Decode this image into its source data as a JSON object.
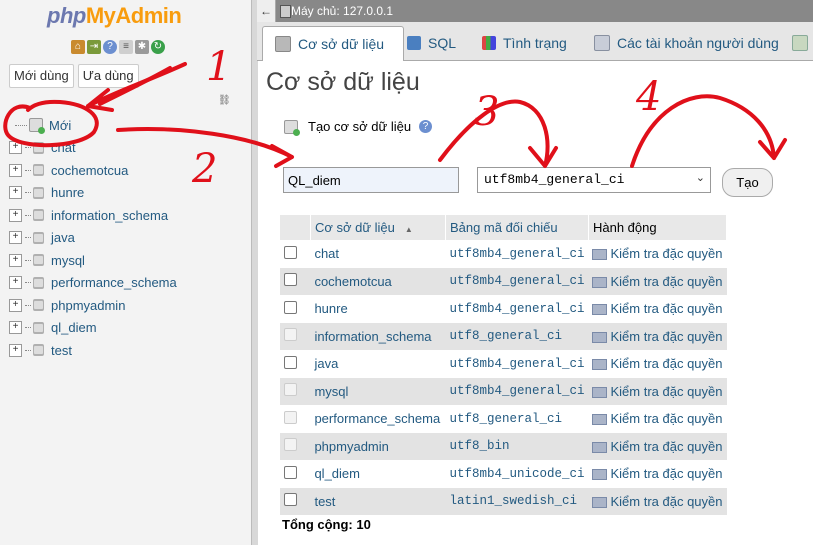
{
  "sidebar": {
    "logo": {
      "php": "php",
      "my": "My",
      "admin": "Admin"
    },
    "quick_icons": [
      "home-icon",
      "logout-icon",
      "help-icon",
      "docs-icon",
      "settings-icon",
      "reload-icon"
    ],
    "recent_tabs": [
      "Mới dùng",
      "Ưa dùng"
    ],
    "new_label": "Mới",
    "databases": [
      "chat",
      "cochemotcua",
      "hunre",
      "information_schema",
      "java",
      "mysql",
      "performance_schema",
      "phpmyadmin",
      "ql_diem",
      "test"
    ]
  },
  "server_bar": {
    "collapse": "←",
    "label": "Máy chủ: 127.0.0.1"
  },
  "tabs": [
    {
      "label": "Cơ sở dữ liệu",
      "icon": "database-icon"
    },
    {
      "label": "SQL",
      "icon": "sql-icon"
    },
    {
      "label": "Tình trạng",
      "icon": "status-icon"
    },
    {
      "label": "Các tài khoản người dùng",
      "icon": "users-icon"
    }
  ],
  "main": {
    "title": "Cơ sở dữ liệu",
    "create_label": "Tạo cơ sở dữ liệu",
    "db_name_value": "QL_diem",
    "collation_value": "utf8mb4_general_ci",
    "create_button": "Tạo",
    "total": "Tổng cộng: 10"
  },
  "table": {
    "headers": [
      "Cơ sở dữ liệu",
      "Bảng mã đối chiếu",
      "Hành động"
    ],
    "rows": [
      {
        "name": "chat",
        "collation": "utf8mb4_general_ci",
        "action": "Kiểm tra đặc quyền",
        "enabled": true
      },
      {
        "name": "cochemotcua",
        "collation": "utf8mb4_general_ci",
        "action": "Kiểm tra đặc quyền",
        "enabled": true
      },
      {
        "name": "hunre",
        "collation": "utf8mb4_general_ci",
        "action": "Kiểm tra đặc quyền",
        "enabled": true
      },
      {
        "name": "information_schema",
        "collation": "utf8_general_ci",
        "action": "Kiểm tra đặc quyền",
        "enabled": false
      },
      {
        "name": "java",
        "collation": "utf8mb4_general_ci",
        "action": "Kiểm tra đặc quyền",
        "enabled": true
      },
      {
        "name": "mysql",
        "collation": "utf8mb4_general_ci",
        "action": "Kiểm tra đặc quyền",
        "enabled": false
      },
      {
        "name": "performance_schema",
        "collation": "utf8_general_ci",
        "action": "Kiểm tra đặc quyền",
        "enabled": false
      },
      {
        "name": "phpmyadmin",
        "collation": "utf8_bin",
        "action": "Kiểm tra đặc quyền",
        "enabled": false
      },
      {
        "name": "ql_diem",
        "collation": "utf8mb4_unicode_ci",
        "action": "Kiểm tra đặc quyền",
        "enabled": true
      },
      {
        "name": "test",
        "collation": "latin1_swedish_ci",
        "action": "Kiểm tra đặc quyền",
        "enabled": true
      }
    ]
  },
  "annotations": {
    "labels": [
      "1",
      "2",
      "3",
      "4"
    ],
    "color": "#e0101a"
  }
}
